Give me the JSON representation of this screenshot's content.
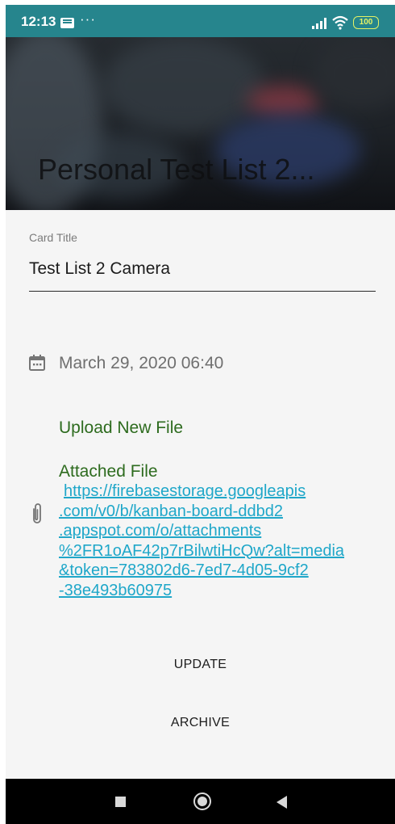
{
  "status_bar": {
    "time": "12:13",
    "dots": "···",
    "battery": "100",
    "bg_color": "#26858d"
  },
  "header": {
    "title": "Personal Test List 2..."
  },
  "form": {
    "card_title_label": "Card Title",
    "card_title_value": "Test List 2 Camera",
    "date": "March 29, 2020 06:40",
    "upload_label": "Upload New File",
    "attached_label": "Attached File",
    "attachment_url_lines": [
      "https://firebasestorage.googleapis",
      ".com/v0/b/kanban-board-ddbd2",
      ".appspot.com/o/attachments",
      "%2FR1oAF42p7rBilwtiHcQw?alt=media",
      "&token=783802d6-7ed7-4d05-9cf2",
      "-38e493b60975"
    ]
  },
  "actions": {
    "update_label": "UPDATE",
    "archive_label": "ARCHIVE"
  },
  "icons": {
    "calendar": "calendar-icon",
    "attachment": "paperclip-icon",
    "nav_recent": "square-icon",
    "nav_home": "circle-icon",
    "nav_back": "triangle-back-icon"
  },
  "colors": {
    "link_green": "#2d6b1e",
    "url_blue": "#1fa7c9"
  }
}
